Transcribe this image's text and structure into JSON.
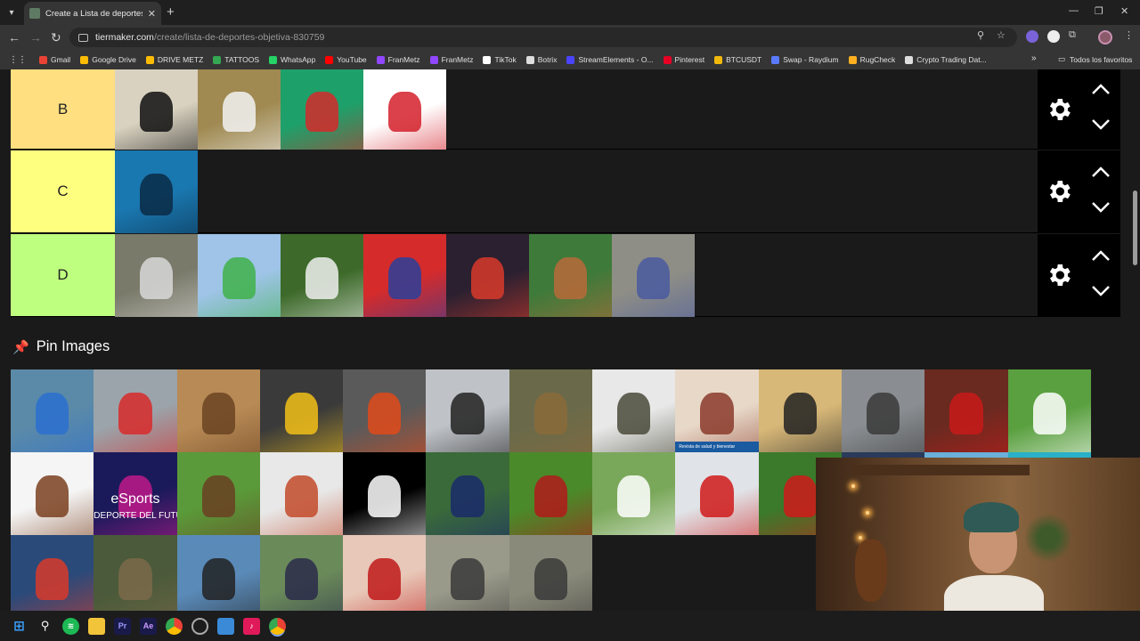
{
  "browser": {
    "tab_title": "Create a Lista de deportes (obje",
    "url_domain": "tiermaker.com",
    "url_path": "/create/lista-de-deportes-objetiva-830759"
  },
  "bookmarks": [
    {
      "label": "Gmail",
      "color": "#ea4335"
    },
    {
      "label": "Google Drive",
      "color": "#fbbc04"
    },
    {
      "label": "DRIVE METZ",
      "color": "#fbbc04"
    },
    {
      "label": "TATTOOS",
      "color": "#34a853"
    },
    {
      "label": "WhatsApp",
      "color": "#25d366"
    },
    {
      "label": "YouTube",
      "color": "#ff0000"
    },
    {
      "label": "FranMetz",
      "color": "#9146ff"
    },
    {
      "label": "FranMetz",
      "color": "#9146ff"
    },
    {
      "label": "TikTok",
      "color": "#ffffff"
    },
    {
      "label": "Botrix",
      "color": "#dddddd"
    },
    {
      "label": "StreamElements - O...",
      "color": "#4b44ff"
    },
    {
      "label": "Pinterest",
      "color": "#e60023"
    },
    {
      "label": "BTCUSDT",
      "color": "#f0b90b"
    },
    {
      "label": "Swap - Raydium",
      "color": "#5a7bff"
    },
    {
      "label": "RugCheck",
      "color": "#ffb020"
    },
    {
      "label": "Crypto Trading Dat...",
      "color": "#dddddd"
    }
  ],
  "bookmarks_folder": "Todos los favoritos",
  "tiers": [
    {
      "label": "B",
      "color": "#ffdf80",
      "items": [
        {
          "name": "chess",
          "bg": "#d9d2c0",
          "accent": "#111111"
        },
        {
          "name": "running-shoes",
          "bg": "#a08a52",
          "accent": "#f2f2f2"
        },
        {
          "name": "billiards",
          "bg": "#1ea06a",
          "accent": "#d42a2a"
        },
        {
          "name": "bowling",
          "bg": "#ffffff",
          "accent": "#d4202a"
        }
      ]
    },
    {
      "label": "C",
      "color": "#ffff7f",
      "items": [
        {
          "name": "scuba-diving",
          "bg": "#1a78b0",
          "accent": "#0a2a45"
        }
      ]
    },
    {
      "label": "D",
      "color": "#bfff7f",
      "items": [
        {
          "name": "paintball",
          "bg": "#7a7a6a",
          "accent": "#d8d8d8"
        },
        {
          "name": "hang-gliding",
          "bg": "#9fc4e8",
          "accent": "#3fb24a"
        },
        {
          "name": "badminton",
          "bg": "#3d6a2a",
          "accent": "#eeeeee"
        },
        {
          "name": "handball-logo",
          "bg": "#d52b2b",
          "accent": "#2b3f9a"
        },
        {
          "name": "handball",
          "bg": "#2a2030",
          "accent": "#d83a2a"
        },
        {
          "name": "baseball",
          "bg": "#3e7a3a",
          "accent": "#b86a3a"
        },
        {
          "name": "petanque",
          "bg": "#8e8e86",
          "accent": "#4a5aa0"
        }
      ]
    }
  ],
  "pin_title": "Pin Images",
  "pin_images": [
    {
      "name": "kayak",
      "bg": "#5b8aa8",
      "accent": "#2b6fd0"
    },
    {
      "name": "canoe-slalom",
      "bg": "#9aa4aa",
      "accent": "#d82a2a"
    },
    {
      "name": "camel-racing",
      "bg": "#b88a55",
      "accent": "#6a4322"
    },
    {
      "name": "touring-cars",
      "bg": "#3a3a3a",
      "accent": "#f2c018"
    },
    {
      "name": "motogp",
      "bg": "#5a5a5a",
      "accent": "#e04a1a"
    },
    {
      "name": "birds",
      "bg": "#bfc3c8",
      "accent": "#222222"
    },
    {
      "name": "hunting",
      "bg": "#6a6a4a",
      "accent": "#8a6a3a"
    },
    {
      "name": "falconry",
      "bg": "#e8e8e8",
      "accent": "#4a4a3a"
    },
    {
      "name": "mountain-bike",
      "bg": "#e8d8c8",
      "accent": "#8a3a2a"
    },
    {
      "name": "cycling",
      "bg": "#d8b878",
      "accent": "#222222"
    },
    {
      "name": "medieval-combat",
      "bg": "#8a8e92",
      "accent": "#3a3a3a"
    },
    {
      "name": "bullfighting",
      "bg": "#6a2a20",
      "accent": "#c81a1a"
    },
    {
      "name": "cricket",
      "bg": "#5aa040",
      "accent": "#ffffff"
    },
    {
      "name": "bodybuilding",
      "bg": "#f5f5f5",
      "accent": "#7a3f1f"
    },
    {
      "name": "esports",
      "bg": "#1a1a5a",
      "accent": "#c01a8a"
    },
    {
      "name": "equestrian",
      "bg": "#5a9a3a",
      "accent": "#6a4022"
    },
    {
      "name": "climbing",
      "bg": "#e8e8e8",
      "accent": "#c24a2a"
    },
    {
      "name": "fencing",
      "bg": "#000000",
      "accent": "#ffffff"
    },
    {
      "name": "american-football",
      "bg": "#3a6a3a",
      "accent": "#1a2a6a"
    },
    {
      "name": "soccer-kick",
      "bg": "#4a8a2a",
      "accent": "#b01a1a"
    },
    {
      "name": "golf",
      "bg": "#7aa85a",
      "accent": "#ffffff"
    },
    {
      "name": "ice-hockey",
      "bg": "#e0e4e8",
      "accent": "#d01a1a"
    },
    {
      "name": "soccer-player",
      "bg": "#3a7a2a",
      "accent": "#d01a1a"
    },
    {
      "name": "marathon",
      "bg": "#2a3a5a",
      "accent": "#e0e0e0"
    },
    {
      "name": "synchronized-swimming",
      "bg": "#6ab0d8",
      "accent": "#9a7a6a"
    },
    {
      "name": "swimming",
      "bg": "#2ab0c8",
      "accent": "#0a5a7a"
    },
    {
      "name": "padel",
      "bg": "#2a4a7a",
      "accent": "#d83a2a"
    },
    {
      "name": "soldiers",
      "bg": "#4a5a3a",
      "accent": "#7a6a4a"
    },
    {
      "name": "skydiving",
      "bg": "#5a8ab8",
      "accent": "#222222"
    },
    {
      "name": "inline-skating",
      "bg": "#6a8a5a",
      "accent": "#2a2a4a"
    },
    {
      "name": "fronton",
      "bg": "#e8c8b8",
      "accent": "#c01a1a"
    },
    {
      "name": "petanque-park",
      "bg": "#9a9a8a",
      "accent": "#3a3a3a"
    },
    {
      "name": "street-race",
      "bg": "#8a8a7a",
      "accent": "#3a3a3a"
    }
  ],
  "pin_overlay_text": {
    "esports_title": "eSports",
    "esports_sub": "DEPORTE DEL FUTU",
    "ice_hockey_banner": "Revista de salud y bienestar"
  }
}
